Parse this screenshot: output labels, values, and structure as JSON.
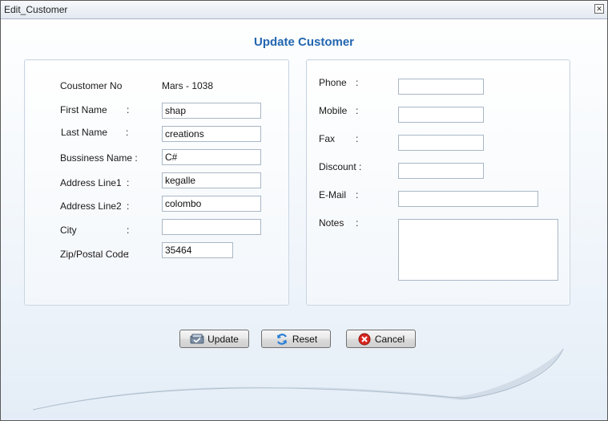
{
  "window": {
    "title": "Edit_Customer"
  },
  "heading": "Update Customer",
  "left_panel": {
    "customer_no": {
      "label": "Coustomer No",
      "value": "Mars - 1038"
    },
    "first_name": {
      "label": "First Name",
      "colon": ":",
      "value": "shap"
    },
    "last_name": {
      "label": "Last Name",
      "colon": ":",
      "value": "creations"
    },
    "business_name": {
      "label": "Bussiness Name :",
      "value": "C#"
    },
    "address1": {
      "label": "Address Line1",
      "colon": ":",
      "value": "kegalle"
    },
    "address2": {
      "label": "Address Line2",
      "colon": ":",
      "value": "colombo"
    },
    "city": {
      "label": "City",
      "colon": ":",
      "value": ""
    },
    "zip": {
      "label": "Zip/Postal Code",
      "colon": ":",
      "value": "35464"
    }
  },
  "right_panel": {
    "phone": {
      "label": "Phone",
      "colon": ":",
      "value": ""
    },
    "mobile": {
      "label": "Mobile",
      "colon": ":",
      "value": ""
    },
    "fax": {
      "label": "Fax",
      "colon": ":",
      "value": ""
    },
    "discount": {
      "label": "Discount :",
      "value": ""
    },
    "email": {
      "label": "E-Mail",
      "colon": ":",
      "value": ""
    },
    "notes": {
      "label": "Notes",
      "colon": ":",
      "value": ""
    }
  },
  "buttons": {
    "update": "Update",
    "reset": "Reset",
    "cancel": "Cancel"
  },
  "icons": {
    "close": "close-icon",
    "update": "update-icon",
    "reset": "refresh-icon",
    "cancel": "cancel-icon"
  },
  "colors": {
    "heading": "#2266b0",
    "cancel_icon": "#d8261f",
    "reset_icon": "#2a7fd4"
  }
}
